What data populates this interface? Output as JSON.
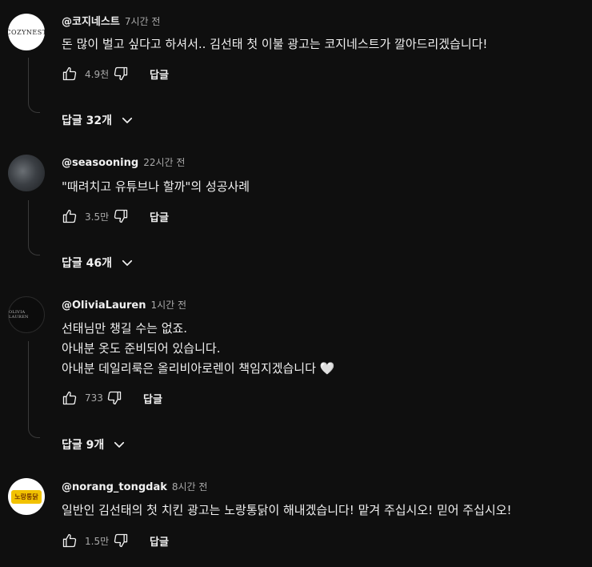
{
  "comments": [
    {
      "handle": "@코지네스트",
      "time": "7시간 전",
      "avatar_text": "COZYNEST",
      "lines": [
        "돈 많이 벌고 싶다고 하셔서.. 김선태 첫 이불 광고는 코지네스트가 깔아드리겠습니다!"
      ],
      "likes": "4.9천",
      "reply_label": "답글",
      "replies_label": "답글 32개"
    },
    {
      "handle": "@seasooning",
      "time": "22시간 전",
      "avatar_text": "",
      "lines": [
        "\"때려치고 유튜브나 할까\"의 성공사례"
      ],
      "likes": "3.5만",
      "reply_label": "답글",
      "replies_label": "답글 46개"
    },
    {
      "handle": "@OliviaLauren",
      "time": "1시간 전",
      "avatar_text": "OLIVIA LAUREN",
      "lines": [
        "선태님만 챙길 수는 없죠.",
        "아내분 옷도 준비되어 있습니다.",
        "아내분 데일리룩은 올리비아로렌이 책임지겠습니다 🤍"
      ],
      "likes": "733",
      "reply_label": "답글",
      "replies_label": "답글 9개"
    },
    {
      "handle": "@norang_tongdak",
      "time": "8시간 전",
      "avatar_text": "노랑통닭",
      "lines": [
        "일반인 김선태의 첫 치킨 광고는 노랑통닭이 해내겠습니다! 맡겨 주십시오! 믿어 주십시오!"
      ],
      "likes": "1.5만",
      "reply_label": "답글",
      "replies_label": ""
    }
  ],
  "icons": {
    "like": "thumbs-up-icon",
    "dislike": "thumbs-down-icon",
    "expand": "chevron-down-icon"
  },
  "colors": {
    "background": "#0f0f0f",
    "text": "#f1f1f1",
    "secondary_text": "#aaaaaa"
  }
}
